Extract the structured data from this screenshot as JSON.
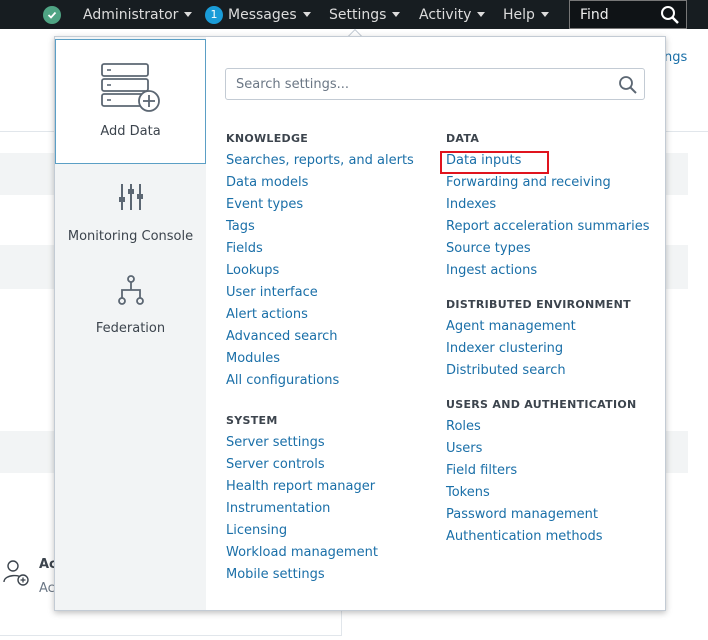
{
  "topbar": {
    "admin_label": "Administrator",
    "messages_count": "1",
    "messages_label": "Messages",
    "settings_label": "Settings",
    "activity_label": "Activity",
    "help_label": "Help",
    "find_label": "Find"
  },
  "background": {
    "right_link": "ngs",
    "user_title": "Ac",
    "user_sub": "Ac"
  },
  "panel": {
    "items": [
      {
        "label": "Add Data",
        "icon": "add-data-icon"
      },
      {
        "label": "Monitoring Console",
        "icon": "sliders-icon"
      },
      {
        "label": "Federation",
        "icon": "hierarchy-icon"
      }
    ]
  },
  "search": {
    "placeholder": "Search settings..."
  },
  "knowledge": {
    "heading": "KNOWLEDGE",
    "links": [
      "Searches, reports, and alerts",
      "Data models",
      "Event types",
      "Tags",
      "Fields",
      "Lookups",
      "User interface",
      "Alert actions",
      "Advanced search",
      "Modules",
      "All configurations"
    ]
  },
  "system": {
    "heading": "SYSTEM",
    "links": [
      "Server settings",
      "Server controls",
      "Health report manager",
      "Instrumentation",
      "Licensing",
      "Workload management",
      "Mobile settings"
    ]
  },
  "data": {
    "heading": "DATA",
    "links": [
      "Data inputs",
      "Forwarding and receiving",
      "Indexes",
      "Report acceleration summaries",
      "Source types",
      "Ingest actions"
    ]
  },
  "distributed": {
    "heading": "DISTRIBUTED ENVIRONMENT",
    "links": [
      "Agent management",
      "Indexer clustering",
      "Distributed search"
    ]
  },
  "users": {
    "heading": "USERS AND AUTHENTICATION",
    "links": [
      "Roles",
      "Users",
      "Field filters",
      "Tokens",
      "Password management",
      "Authentication methods"
    ]
  },
  "colors": {
    "accent": "#1a6fa8",
    "highlight": "#e0141e",
    "topbar": "#171d21"
  }
}
